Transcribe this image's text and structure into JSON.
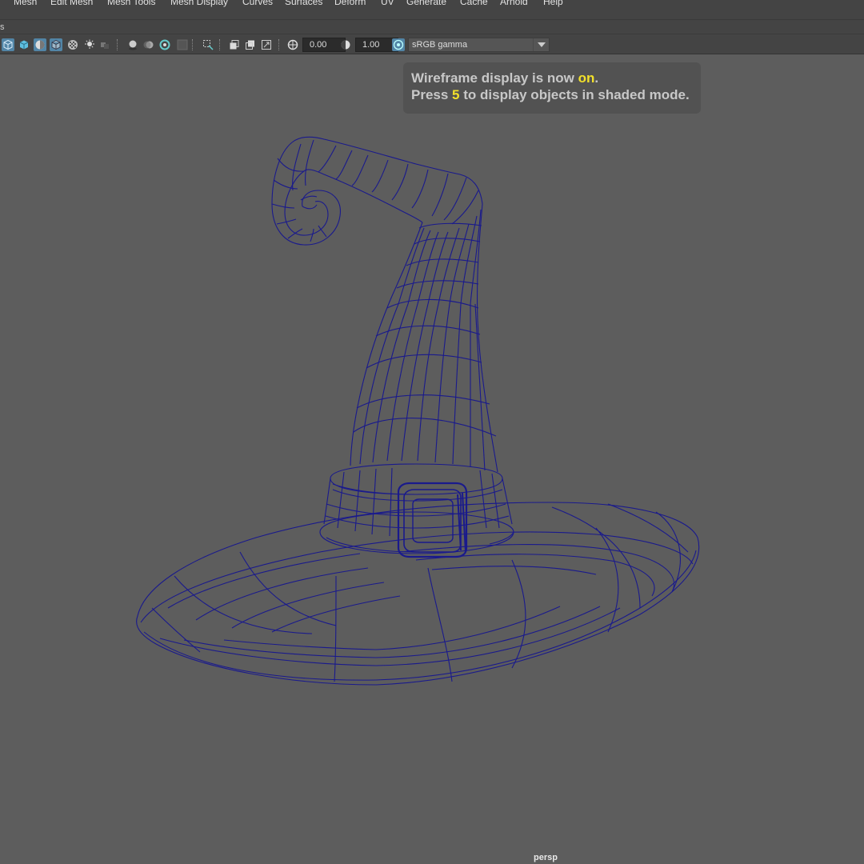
{
  "menu": {
    "items": [
      "Mesh",
      "Edit Mesh",
      "Mesh Tools",
      "Mesh Display",
      "Curves",
      "Surfaces",
      "Deform",
      "UV",
      "Generate",
      "Cache",
      "Arnold",
      "Help"
    ]
  },
  "strip": {
    "text": "s"
  },
  "toolbar": {
    "icons": [
      "wireframe-cube-icon",
      "shaded-cube-icon",
      "wireframe-on-shaded-icon",
      "textured-cube-icon",
      "checker-icon",
      "light-icon",
      "shadows-icon",
      "ambient-occlusion-icon",
      "motion-blur-icon",
      "antialias-icon",
      "depth-of-field-icon",
      "isolate-select-icon",
      "xray-icon",
      "xray-joints-icon",
      "xray-components-icon",
      "exposure-icon",
      "gamma-icon",
      "color-management-icon"
    ],
    "exposure_value": "0.00",
    "gamma_value": "1.00",
    "color_space": "sRGB gamma"
  },
  "hud": {
    "line1_prefix": "Wireframe display is now ",
    "line1_highlight": "on",
    "line1_suffix": ".",
    "line2_prefix": "Press ",
    "line2_highlight": "5",
    "line2_suffix": " to display objects in shaded mode."
  },
  "viewport": {
    "camera": "persp",
    "wire_color": "#1a1a8c",
    "highlight_color": "#f2e02a"
  }
}
